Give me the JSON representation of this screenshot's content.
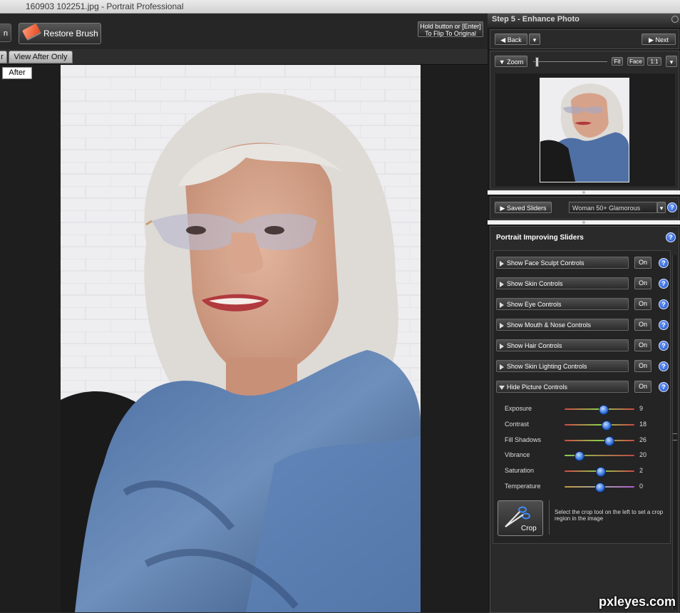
{
  "window": {
    "title": "160903 102251.jpg - Portrait Professional"
  },
  "toolbar": {
    "prev_label": "n",
    "restore_label": "Restore Brush",
    "flip_line1": "Hold button or [Enter]",
    "flip_line2": "To Flip To Original"
  },
  "tabs": [
    {
      "label": "r"
    },
    {
      "label": "View After Only"
    }
  ],
  "canvas": {
    "after_label": "After"
  },
  "right": {
    "step_title": "Step 5 - Enhance Photo",
    "nav": {
      "back": "Back",
      "next": "Next"
    },
    "zoom": {
      "label": "Zoom",
      "fit": "Fit",
      "face": "Face",
      "one_to_one": "1:1",
      "level": 0.03
    },
    "saved": {
      "label": "Saved Sliders",
      "preset": "Woman 50+ Glamorous"
    },
    "panel_title": "Portrait Improving Sliders",
    "sections": [
      {
        "label": "Show Face Sculpt Controls",
        "toggle": "On"
      },
      {
        "label": "Show Skin Controls",
        "toggle": "On"
      },
      {
        "label": "Show Eye Controls",
        "toggle": "On"
      },
      {
        "label": "Show Mouth & Nose Controls",
        "toggle": "On"
      },
      {
        "label": "Show Hair Controls",
        "toggle": "On"
      },
      {
        "label": "Show Skin Lighting Controls",
        "toggle": "On"
      },
      {
        "label": "Hide Picture Controls",
        "toggle": "On"
      }
    ],
    "sliders": [
      {
        "label": "Exposure",
        "value": "9",
        "pos": 0.55,
        "track": "linear-gradient(90deg,#d04848,#8ad04a 50%,#d04848)"
      },
      {
        "label": "Contrast",
        "value": "18",
        "pos": 0.59,
        "track": "linear-gradient(90deg,#d04848,#8ad04a 50%,#d04848)"
      },
      {
        "label": "Fill Shadows",
        "value": "26",
        "pos": 0.63,
        "track": "linear-gradient(90deg,#d04848,#8ad04a 50%,#d04848)"
      },
      {
        "label": "Vibrance",
        "value": "20",
        "pos": 0.2,
        "track": "linear-gradient(90deg,#8ad04a,#c04848)"
      },
      {
        "label": "Saturation",
        "value": "2",
        "pos": 0.51,
        "track": "linear-gradient(90deg,#d04848,#8ad04a 50%,#d04848)"
      },
      {
        "label": "Temperature",
        "value": "0",
        "pos": 0.5,
        "track": "linear-gradient(90deg,#c29a42,#a0a0a0 50%,#b45ccf)"
      }
    ],
    "crop": {
      "label": "Crop",
      "text": "Select the crop tool on the left to set a crop region in the image"
    }
  },
  "watermark": "pxleyes.com"
}
